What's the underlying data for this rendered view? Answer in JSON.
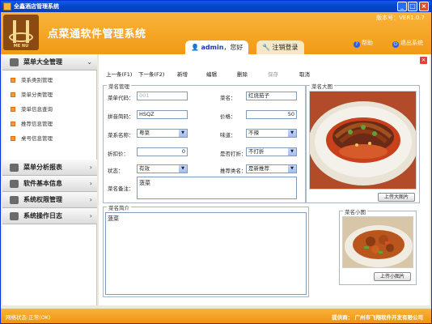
{
  "window": {
    "title": "全鑫酒店管理系统"
  },
  "header": {
    "app_title": "点菜通软件管理系统",
    "version": "版本号：VER1.0.7",
    "user": {
      "name": "admin",
      "greeting": "，您好"
    },
    "logout_label": "注销登录",
    "help_label": "帮助",
    "exit_label": "退出系统",
    "logo_text": "ME NU"
  },
  "sidebar": {
    "sections": [
      {
        "label": "菜单大全管理",
        "expanded": true,
        "items": [
          "菜系类别管理",
          "菜单分类管理",
          "菜单信息查询",
          "推荐信息管理",
          "桌号信息管理"
        ]
      },
      {
        "label": "菜单分析报表"
      },
      {
        "label": "软件基本信息"
      },
      {
        "label": "系统权限管理"
      },
      {
        "label": "系统操作日志"
      }
    ]
  },
  "toolbar": {
    "prev": "上一条(F1)",
    "next": "下一条(F2)",
    "add": "新增",
    "edit": "编辑",
    "delete": "删除",
    "save": "保存",
    "cancel": "取消"
  },
  "form": {
    "group_title": "菜名管理",
    "code_label": "菜单代码：",
    "code_value": "001",
    "name_label": "菜名：",
    "name_value": "红烧茄子",
    "pinyin_label": "拼音简码：",
    "pinyin_value": "HSQZ",
    "price_label": "价格：",
    "price_value": "50",
    "category_label": "菜系名称：",
    "category_value": "粤菜",
    "taste_label": "味道：",
    "taste_value": "不辣",
    "discount_label": "折扣价：",
    "discount_value": "0",
    "is_discount_label": "是否打折：",
    "is_discount_value": "不打折",
    "status_label": "状态：",
    "status_value": "有效",
    "recommend_label": "推荐类名：",
    "recommend_value": "是新推荐",
    "remark_label": "菜名备注：",
    "remark_value": "菠菜"
  },
  "large_image": {
    "title": "菜名大图",
    "button": "上传大图片"
  },
  "intro": {
    "title": "菜名简介",
    "value": "菠菜"
  },
  "small_image": {
    "title": "菜名小图",
    "button": "上传小图片"
  },
  "statusbar": {
    "left": "网络状态:正常(OK)",
    "right": "提供商：  广州市飞翔软件开发有限公司"
  },
  "colors": {
    "brand_orange": "#f29a16",
    "titlebar_blue": "#0843c7"
  }
}
